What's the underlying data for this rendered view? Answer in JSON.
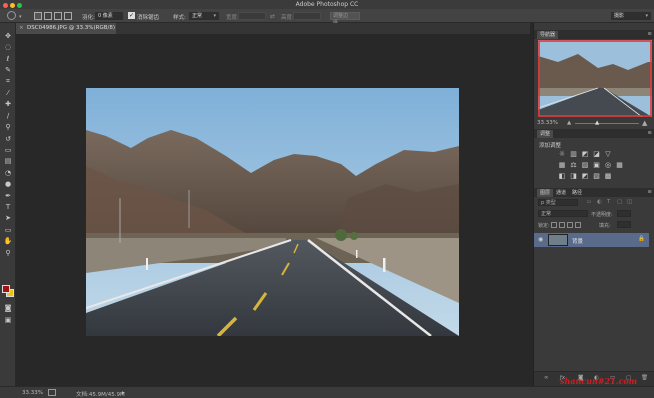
{
  "app": {
    "title": "Adobe Photoshop CC"
  },
  "window_controls": {
    "close_color": "#fc5f57",
    "minimize_color": "#fdbc2e",
    "zoom_color": "#28c840"
  },
  "options_bar": {
    "feather_label": "羽化:",
    "feather_value": "0 像素",
    "antialias_label": "消除锯齿",
    "antialias_checked": true,
    "style_label": "样式:",
    "style_value": "正常",
    "width_label": "宽度:",
    "height_label": "高度:",
    "refine_button": "调整边缘...",
    "workspace_value": "摄影"
  },
  "document_tab": {
    "label": "DSC04986.JPG @ 33.3%(RGB/8)"
  },
  "tools": [
    {
      "name": "move-tool",
      "icon": "✥"
    },
    {
      "name": "marquee-tool",
      "icon": "◌"
    },
    {
      "name": "lasso-tool",
      "icon": "ℓ"
    },
    {
      "name": "quick-select-tool",
      "icon": "✎"
    },
    {
      "name": "crop-tool",
      "icon": "⌗"
    },
    {
      "name": "eyedropper-tool",
      "icon": "⁄"
    },
    {
      "name": "healing-brush-tool",
      "icon": "✚"
    },
    {
      "name": "brush-tool",
      "icon": "∕"
    },
    {
      "name": "clone-stamp-tool",
      "icon": "⚲"
    },
    {
      "name": "history-brush-tool",
      "icon": "↺"
    },
    {
      "name": "eraser-tool",
      "icon": "▭"
    },
    {
      "name": "gradient-tool",
      "icon": "▤"
    },
    {
      "name": "blur-tool",
      "icon": "◔"
    },
    {
      "name": "dodge-tool",
      "icon": "●"
    },
    {
      "name": "pen-tool",
      "icon": "✒"
    },
    {
      "name": "type-tool",
      "icon": "T"
    },
    {
      "name": "path-select-tool",
      "icon": "➤"
    },
    {
      "name": "shape-tool",
      "icon": "▭"
    },
    {
      "name": "hand-tool",
      "icon": "✋"
    },
    {
      "name": "zoom-tool",
      "icon": "⚲"
    }
  ],
  "colors": {
    "foreground": "#a31212",
    "background": "#e8c21a"
  },
  "status_bar": {
    "zoom": "33.33%",
    "doc_info": "文档:45.9M/45.9M"
  },
  "navigator": {
    "tab_label": "导航器",
    "zoom": "33.33%",
    "view_box_color": "#e03a3a"
  },
  "adjustments": {
    "tab_label": "调整",
    "title": "添加调整",
    "row1": [
      "☼",
      "▥",
      "◩",
      "◪",
      "▽"
    ],
    "row2": [
      "▦",
      "⚖",
      "▨",
      "▣",
      "◎",
      "▦"
    ],
    "row3": [
      "◧",
      "◨",
      "◩",
      "▧",
      "▩"
    ]
  },
  "layers": {
    "tabs": [
      "图层",
      "通道",
      "路径"
    ],
    "filter_label": "p 类型",
    "blend_mode": "正常",
    "opacity_label": "不透明度:",
    "lock_label": "锁定:",
    "fill_label": "填充:",
    "layer_name": "背景",
    "selected_color": "#5a6a8a"
  },
  "watermark": {
    "text": "shancun#21.com",
    "color": "#d21e1e"
  }
}
